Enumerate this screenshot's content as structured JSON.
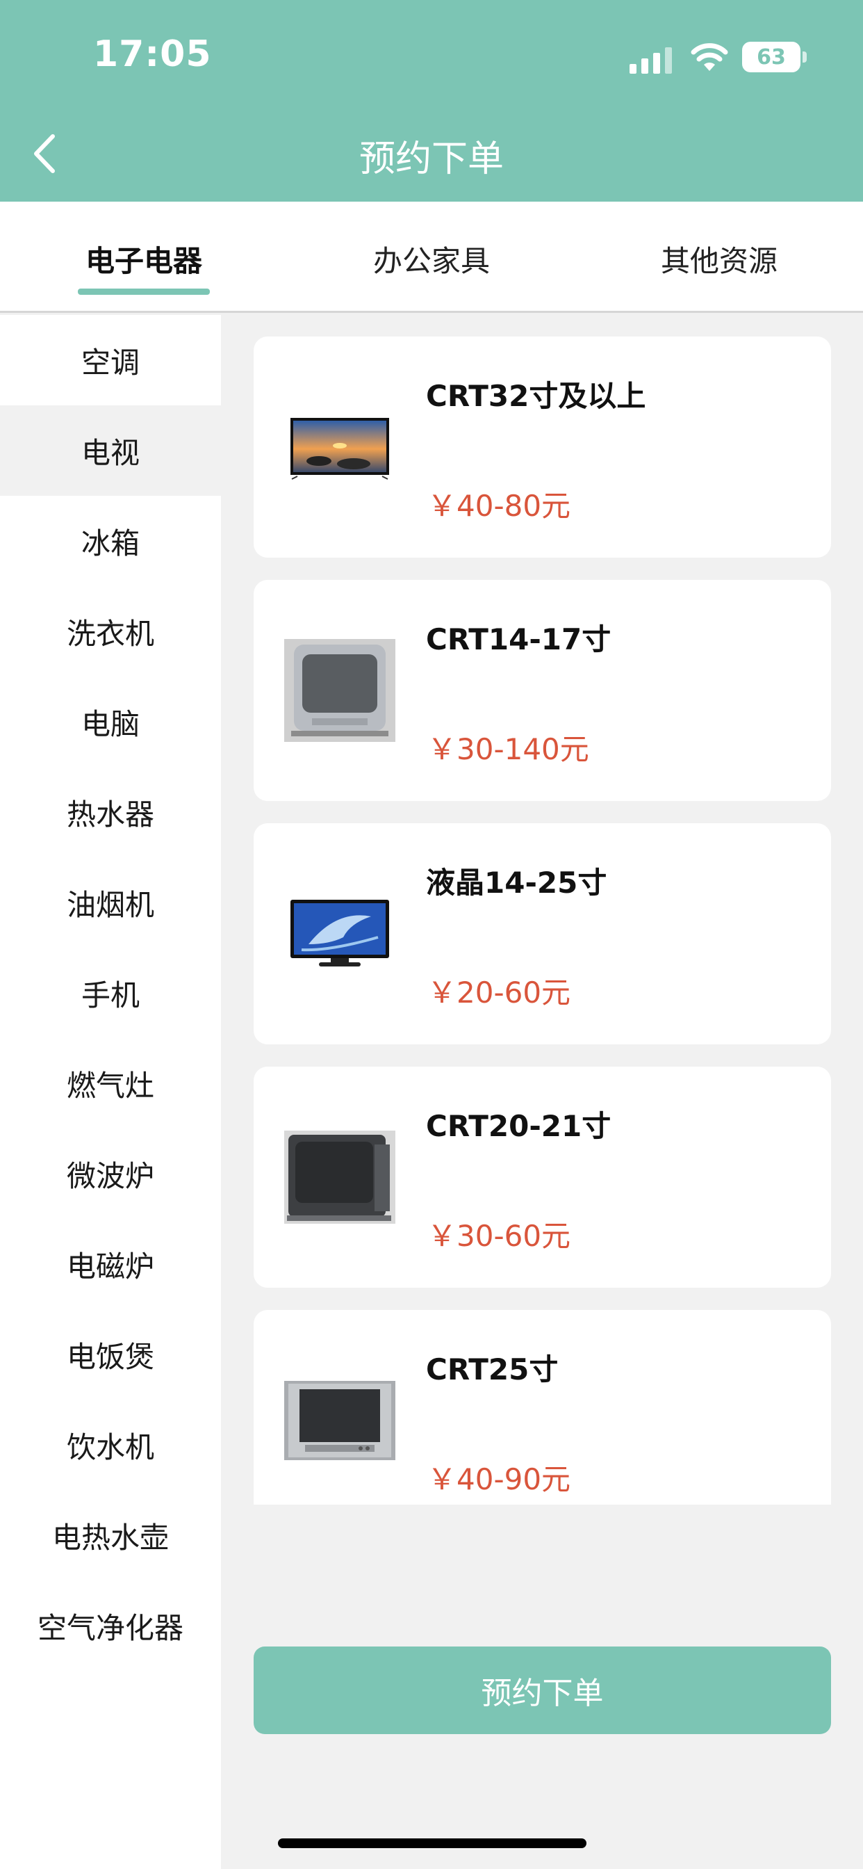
{
  "status_bar": {
    "time": "17:05",
    "battery": "63"
  },
  "nav": {
    "title": "预约下单",
    "back_icon": "chevron-left-icon"
  },
  "tabs": [
    {
      "label": "电子电器",
      "active": true
    },
    {
      "label": "办公家具",
      "active": false
    },
    {
      "label": "其他资源",
      "active": false
    }
  ],
  "sidebar": {
    "items": [
      {
        "label": "空调"
      },
      {
        "label": "电视",
        "active": true
      },
      {
        "label": "冰箱"
      },
      {
        "label": "洗衣机"
      },
      {
        "label": "电脑"
      },
      {
        "label": "热水器"
      },
      {
        "label": "油烟机"
      },
      {
        "label": "手机"
      },
      {
        "label": "燃气灶"
      },
      {
        "label": "微波炉"
      },
      {
        "label": "电磁炉"
      },
      {
        "label": "电饭煲"
      },
      {
        "label": "饮水机"
      },
      {
        "label": "电热水壶"
      },
      {
        "label": "空气净化器"
      }
    ]
  },
  "products": [
    {
      "name": "CRT32寸及以上",
      "price": "￥40-80元",
      "image": "flat-tv-landscape-image"
    },
    {
      "name": "CRT14-17寸",
      "price": "￥30-140元",
      "image": "crt-tv-silver-image"
    },
    {
      "name": "液晶14-25寸",
      "price": "￥20-60元",
      "image": "lcd-tv-dolphin-image"
    },
    {
      "name": "CRT20-21寸",
      "price": "￥30-60元",
      "image": "crt-tv-black-image"
    },
    {
      "name": "CRT25寸",
      "price": "￥40-90元",
      "image": "crt-tv-grey-image"
    }
  ],
  "order_button": {
    "label": "预约下单"
  },
  "colors": {
    "accent": "#7cc5b4",
    "price": "#d9553b",
    "background": "#f1f1f1"
  }
}
